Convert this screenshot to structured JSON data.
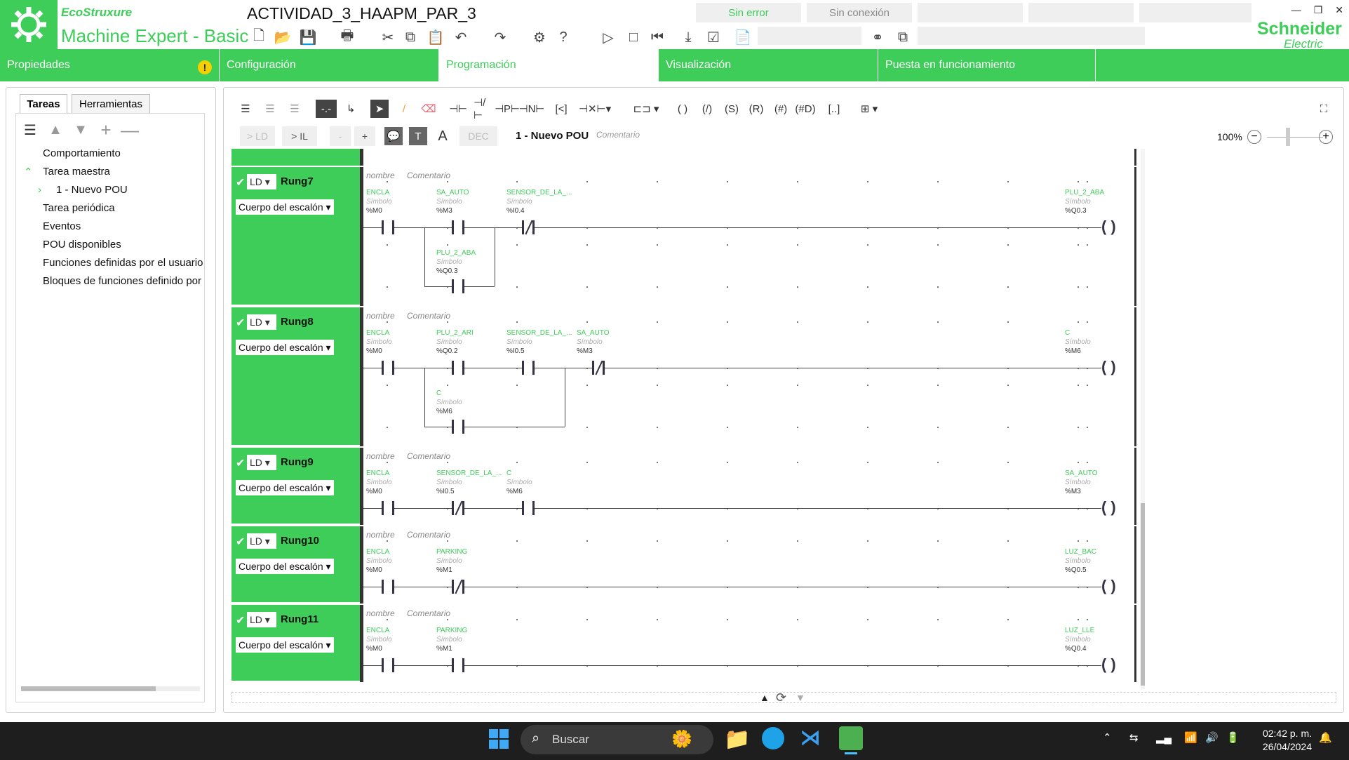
{
  "app": {
    "brand_top": "EcoStruxure",
    "brand_name": "Machine Expert - Basic",
    "doc_title": "ACTIVIDAD_3_HAAPM_PAR_3",
    "status_error": "Sin error",
    "status_conn": "Sin conexión",
    "vendor": "Schneider",
    "vendor_sub": "Electric"
  },
  "nav": {
    "tabs": [
      "Propiedades",
      "Configuración",
      "Programación",
      "Visualización",
      "Puesta en funcionamiento"
    ],
    "active": "Programación"
  },
  "left": {
    "tabs": [
      "Tareas",
      "Herramientas"
    ],
    "tree": [
      "Comportamiento",
      "Tarea maestra",
      "1 - Nuevo POU",
      "Tarea periódica",
      "Eventos",
      "POU disponibles",
      "Funciones definidas por el usuario",
      "Bloques de funciones definido por"
    ]
  },
  "editor": {
    "to_ld": "> LD",
    "to_il": "> IL",
    "minus": "-",
    "plus": "+",
    "dec": "DEC",
    "pou_title": "1 - Nuevo POU",
    "comment": "Comentario",
    "zoom": "100%"
  },
  "rung_common": {
    "lang": "LD",
    "body": "Cuerpo del escalón",
    "nombre": "nombre",
    "comentario": "Comentario",
    "simbolo": "Símbolo"
  },
  "rungs": [
    {
      "name": "Rung7",
      "contacts": [
        {
          "label": "ENCLA",
          "addr": "%M0"
        },
        {
          "label": "SA_AUTO",
          "addr": "%M3"
        },
        {
          "label": "SENSOR_DE_LA_...",
          "addr": "%I0.4"
        }
      ],
      "branch": {
        "label": "PLU_2_ABA",
        "addr": "%Q0.3"
      },
      "coil": {
        "label": "PLU_2_ABA",
        "addr": "%Q0.3"
      }
    },
    {
      "name": "Rung8",
      "contacts": [
        {
          "label": "ENCLA",
          "addr": "%M0"
        },
        {
          "label": "PLU_2_ARI",
          "addr": "%Q0.2"
        },
        {
          "label": "SENSOR_DE_LA_...",
          "addr": "%I0.5"
        },
        {
          "label": "SA_AUTO",
          "addr": "%M3"
        }
      ],
      "branch": {
        "label": "C",
        "addr": "%M6"
      },
      "coil": {
        "label": "C",
        "addr": "%M6"
      }
    },
    {
      "name": "Rung9",
      "contacts": [
        {
          "label": "ENCLA",
          "addr": "%M0"
        },
        {
          "label": "SENSOR_DE_LA_...",
          "addr": "%I0.5"
        },
        {
          "label": "C",
          "addr": "%M6"
        }
      ],
      "coil": {
        "label": "SA_AUTO",
        "addr": "%M3"
      }
    },
    {
      "name": "Rung10",
      "contacts": [
        {
          "label": "ENCLA",
          "addr": "%M0"
        },
        {
          "label": "PARKING",
          "addr": "%M1"
        }
      ],
      "coil": {
        "label": "LUZ_BAC",
        "addr": "%Q0.5"
      }
    },
    {
      "name": "Rung11",
      "contacts": [
        {
          "label": "ENCLA",
          "addr": "%M0"
        },
        {
          "label": "PARKING",
          "addr": "%M1"
        }
      ],
      "coil": {
        "label": "LUZ_LLE",
        "addr": "%Q0.4"
      }
    }
  ],
  "taskbar": {
    "search": "Buscar",
    "time": "02:42 p. m.",
    "date": "26/04/2024"
  }
}
